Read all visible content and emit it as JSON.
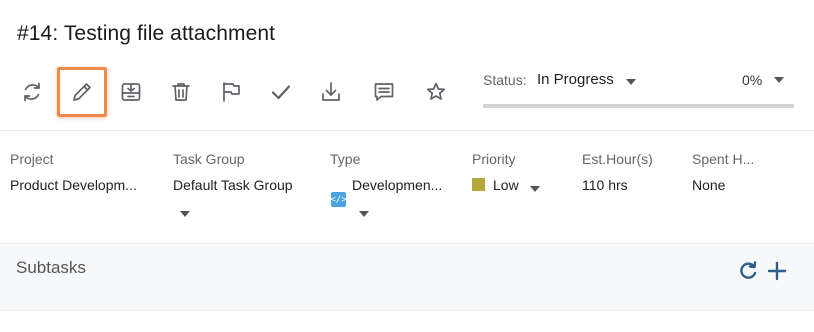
{
  "task": {
    "title": "#14: Testing file attachment"
  },
  "toolbar": {
    "buttons": [
      {
        "icon": "refresh-icon"
      },
      {
        "icon": "pencil-icon",
        "highlighted": true
      },
      {
        "icon": "archive-icon"
      },
      {
        "icon": "trash-icon"
      },
      {
        "icon": "flag-icon"
      },
      {
        "icon": "checkmark-icon"
      },
      {
        "icon": "download-icon"
      },
      {
        "icon": "comment-icon"
      },
      {
        "icon": "star-icon"
      }
    ]
  },
  "status": {
    "label": "Status:",
    "value": "In Progress",
    "percent": "0%",
    "progress_fraction": 0.0
  },
  "fields": [
    {
      "label": "Project",
      "value": "Product Developm..."
    },
    {
      "label": "Task Group",
      "value": "Default Task Group"
    },
    {
      "label": "Type",
      "value": "Developmen...",
      "icon": "code-icon"
    },
    {
      "label": "Priority",
      "value": "Low",
      "color": "#b5a83a"
    },
    {
      "label": "Est.Hour(s)",
      "value": "110 hrs"
    },
    {
      "label": "Spent H...",
      "value": "None"
    }
  ],
  "subtasks": {
    "title": "Subtasks"
  },
  "colors": {
    "highlight": "#f08a4b",
    "accent": "#2c5f8a",
    "type_icon": "#4aa3df",
    "priority_low": "#b5a83a"
  }
}
